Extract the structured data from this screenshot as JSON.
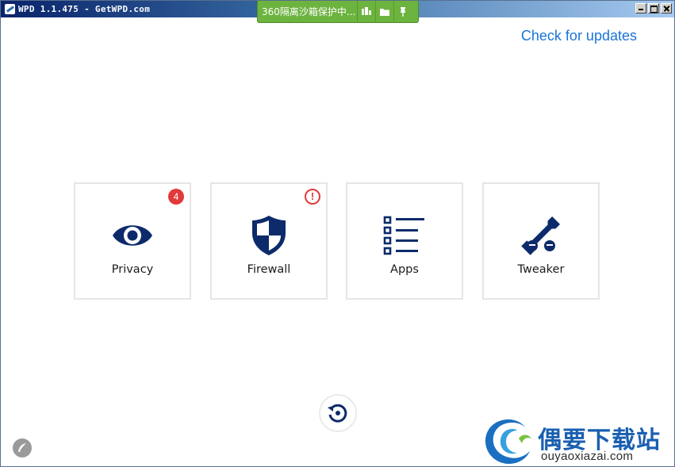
{
  "window": {
    "title": "WPD 1.1.475 - GetWPD.com",
    "app_icon": "wpd-feather-icon"
  },
  "sandbox_bar": {
    "text": "360隔离沙箱保护中...",
    "icons": [
      "network-plug-icon",
      "folder-icon",
      "pin-icon"
    ],
    "background": "#6db33f"
  },
  "header": {
    "check_updates_label": "Check for updates",
    "link_color": "#1a73d9"
  },
  "tiles": [
    {
      "label": "Privacy",
      "icon": "eye-icon",
      "badge": "4"
    },
    {
      "label": "Firewall",
      "icon": "shield-icon",
      "alert": "!"
    },
    {
      "label": "Apps",
      "icon": "list-icon"
    },
    {
      "label": "Tweaker",
      "icon": "wrench-icon"
    }
  ],
  "footer": {
    "restore_icon": "restore-icon",
    "feather_icon": "feather-icon"
  },
  "watermark": {
    "title": "偶要下载站",
    "subtitle": "ouyaoxiazai.com"
  },
  "colors": {
    "icon_navy": "#0d2b6b",
    "badge_red": "#e23a3a",
    "tile_border": "#e6e6e6"
  }
}
